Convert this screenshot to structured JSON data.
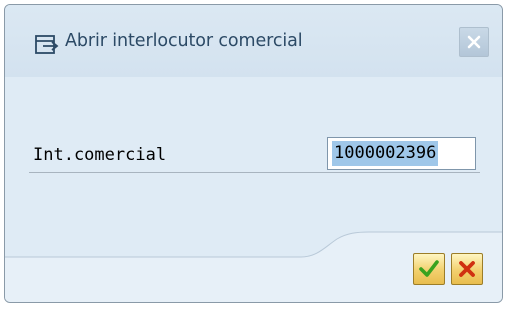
{
  "dialog": {
    "title": "Abrir interlocutor comercial",
    "title_icon": "open-document-icon",
    "close_icon": "close-icon"
  },
  "form": {
    "field_label": "Int.comercial",
    "field_value": "1000002396"
  },
  "buttons": {
    "confirm_icon": "checkmark-icon",
    "cancel_icon": "cancel-x-icon"
  },
  "colors": {
    "dialog_background": "#dfebf5",
    "title_text": "#2c4a66",
    "selection_highlight": "#9fc7e9",
    "button_gold": "#f2d06e",
    "confirm_green": "#3aa21f",
    "cancel_red": "#d03010"
  }
}
